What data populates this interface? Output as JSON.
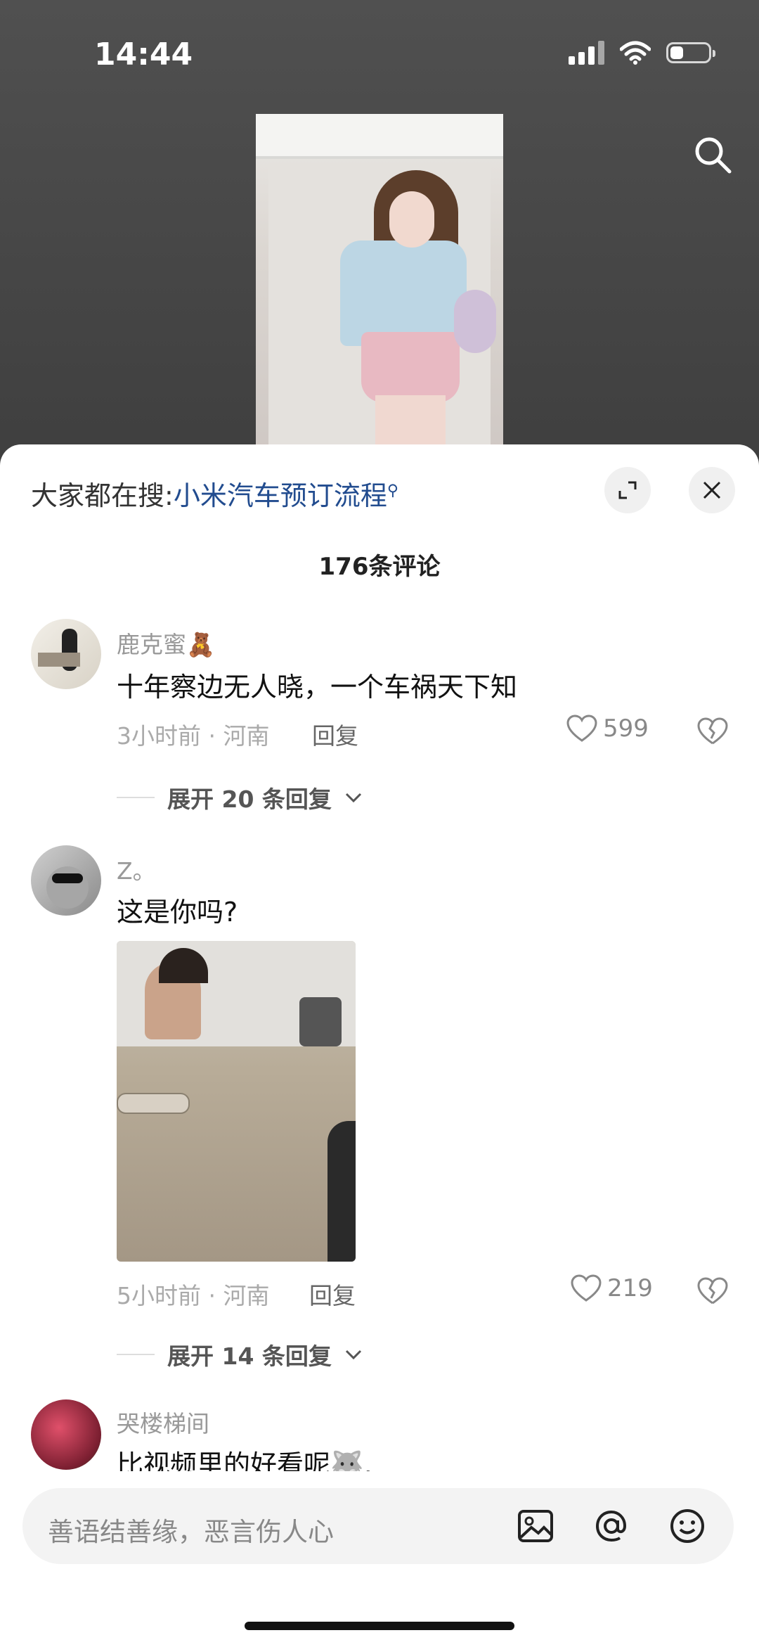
{
  "status_bar": {
    "time": "14:44"
  },
  "sheet": {
    "hot_search_label": "大家都在搜:",
    "hot_search_keyword": "小米汽车预订流程",
    "comment_count": "176条评论"
  },
  "comments": [
    {
      "username": "鹿克蜜",
      "username_emoji": "🧸",
      "text": "十年察边无人晓，一个车祸天下知",
      "time_location": "3小时前 · 河南",
      "reply_label": "回复",
      "likes": "599",
      "expand_replies": "展开 20 条回复"
    },
    {
      "username": "Z。",
      "text": "这是你吗?",
      "time_location": "5小时前 · 河南",
      "reply_label": "回复",
      "likes": "219",
      "expand_replies": "展开 14 条回复"
    },
    {
      "username": "哭楼梯间",
      "text": "比视频里的好看呢",
      "text_suffix": "🐺,"
    }
  ],
  "input": {
    "placeholder": "善语结善缘，恶言伤人心"
  },
  "icons": {
    "search": "search-icon",
    "expand": "expand-icon",
    "close": "close-icon",
    "heart": "heart-icon",
    "broken_heart": "broken-heart-icon",
    "image": "image-icon",
    "at": "at-icon",
    "emoji": "emoji-icon"
  },
  "colors": {
    "keyword": "#224c8f",
    "sheet_bg": "#ffffff",
    "backdrop": "#4a4a4a"
  }
}
